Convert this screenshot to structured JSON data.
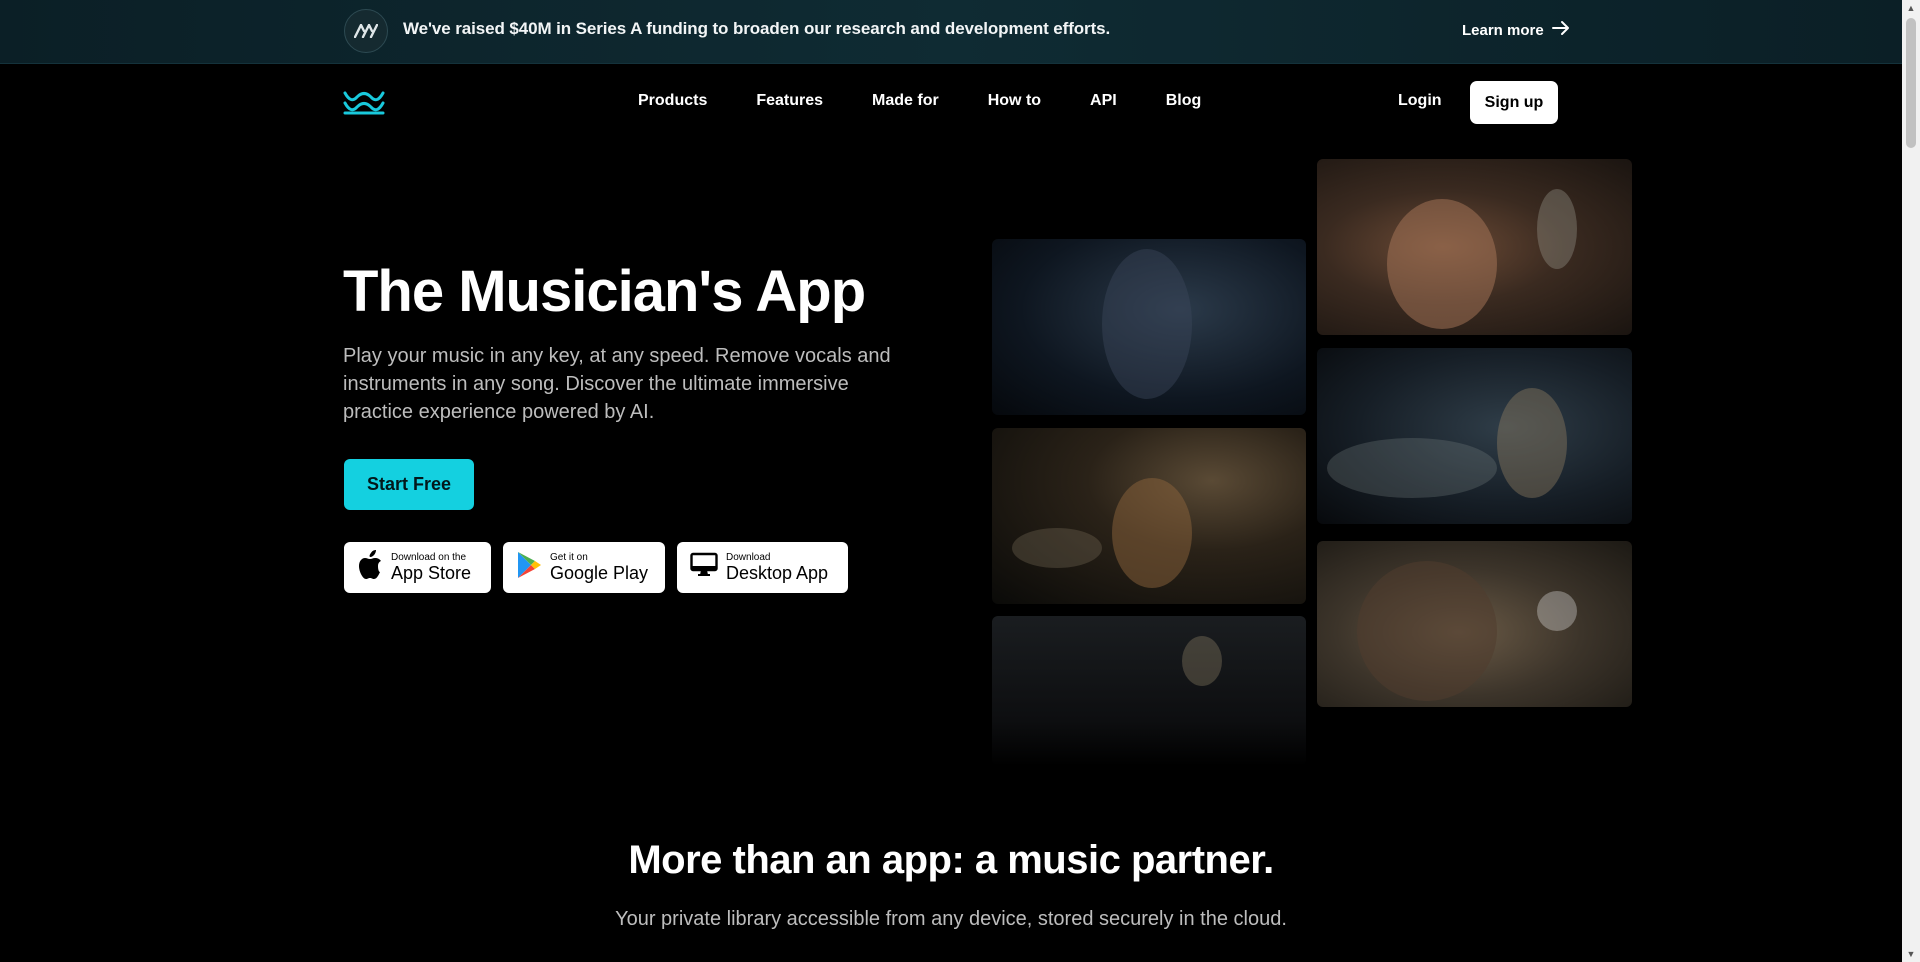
{
  "announcement": {
    "message": "We've raised $40M in Series A funding to broaden our research and development efforts.",
    "link_label": "Learn more",
    "badge_icon": "moises-ai-logo-icon",
    "link_icon": "arrow-right-icon"
  },
  "nav": {
    "logo_icon": "moises-wave-logo-icon",
    "items": [
      "Products",
      "Features",
      "Made for",
      "How to",
      "API",
      "Blog"
    ],
    "login_label": "Login",
    "signup_label": "Sign up"
  },
  "hero": {
    "title": "The Musician's App",
    "description": "Play your music in any key, at any speed. Remove vocals and instruments in any song. Discover the ultimate immersive practice experience powered by AI.",
    "cta_label": "Start Free",
    "stores": [
      {
        "small": "Download on the",
        "big": "App Store",
        "icon": "apple-icon"
      },
      {
        "small": "Get it on",
        "big": "Google Play",
        "icon": "google-play-icon"
      },
      {
        "small": "Download",
        "big": "Desktop App",
        "icon": "desktop-icon"
      }
    ]
  },
  "section": {
    "title": "More than an app: a music partner.",
    "subtitle": "Your private library accessible from any device, stored securely in the cloud."
  },
  "colors": {
    "accent": "#14d0e0",
    "background": "#000000",
    "announcement_bg": "#0f2b33"
  }
}
